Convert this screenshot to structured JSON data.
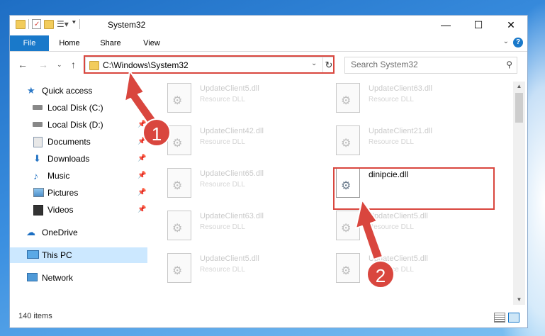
{
  "window": {
    "title": "System32",
    "controls": {
      "minimize": "—",
      "maximize": "☐",
      "close": "✕"
    }
  },
  "ribbon": {
    "tabs": [
      {
        "label": "File"
      },
      {
        "label": "Home"
      },
      {
        "label": "Share"
      },
      {
        "label": "View"
      }
    ],
    "help": "?"
  },
  "navigation": {
    "address": "C:\\Windows\\System32",
    "search_placeholder": "Search System32"
  },
  "sidebar": {
    "items": [
      {
        "label": "Quick access",
        "icon": "star-icon"
      },
      {
        "label": "Local Disk (C:)",
        "icon": "drive-icon",
        "pinned": true
      },
      {
        "label": "Local Disk (D:)",
        "icon": "drive-icon",
        "pinned": true
      },
      {
        "label": "Documents",
        "icon": "documents-icon",
        "pinned": true
      },
      {
        "label": "Downloads",
        "icon": "download-icon",
        "pinned": true
      },
      {
        "label": "Music",
        "icon": "music-icon",
        "pinned": true
      },
      {
        "label": "Pictures",
        "icon": "pictures-icon",
        "pinned": true
      },
      {
        "label": "Videos",
        "icon": "videos-icon",
        "pinned": true
      },
      {
        "label": "OneDrive",
        "icon": "cloud-icon"
      },
      {
        "label": "This PC",
        "icon": "computer-icon",
        "selected": true
      },
      {
        "label": "Network",
        "icon": "network-icon"
      }
    ]
  },
  "files": {
    "left_column": [
      {
        "name": "UpdateClient5.dll",
        "type": "Resource DLL"
      },
      {
        "name": "UpdateClient42.dll",
        "type": "Resource DLL"
      },
      {
        "name": "UpdateClient65.dll",
        "type": "Resource DLL"
      },
      {
        "name": "UpdateClient63.dll",
        "type": "Resource DLL"
      },
      {
        "name": "UpdateClient5.dll",
        "type": "Resource DLL"
      }
    ],
    "right_column": [
      {
        "name": "UpdateClient63.dll",
        "type": "Resource DLL"
      },
      {
        "name": "UpdateClient21.dll",
        "type": "Resource DLL"
      },
      {
        "name": "dinipcie.dll",
        "type": ""
      },
      {
        "name": "UpdateClient5.dll",
        "type": "Resource DLL"
      },
      {
        "name": "UpdateClient5.dll",
        "type": "Resource DLL"
      }
    ]
  },
  "status": {
    "item_count": "140 items"
  },
  "annotations": {
    "step1": "1",
    "step2": "2",
    "color": "#d9463e"
  }
}
